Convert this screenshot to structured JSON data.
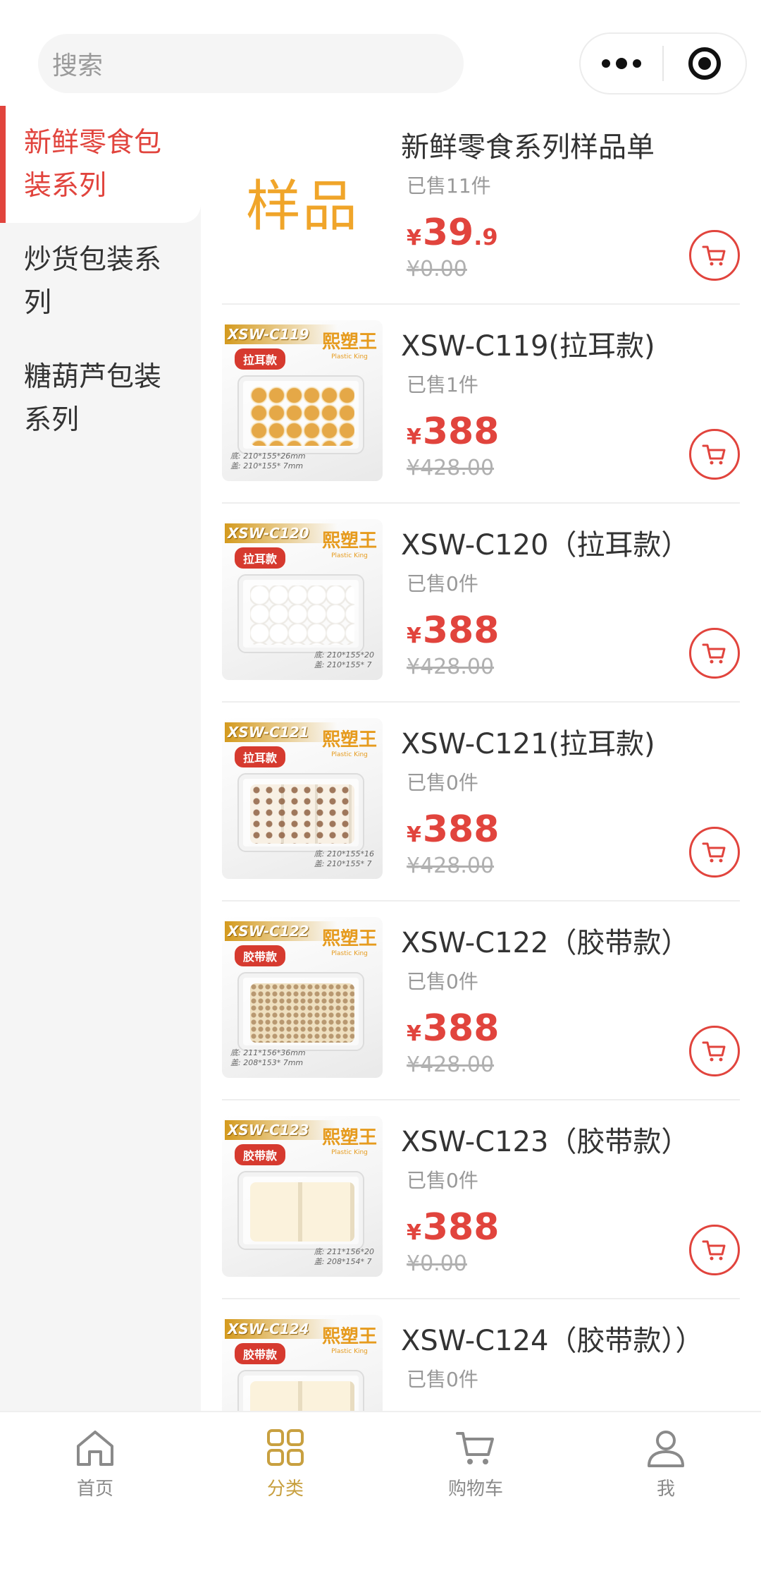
{
  "search": {
    "placeholder": "搜索"
  },
  "capsule": {
    "more_icon": "more-dots-icon",
    "target_icon": "target-icon"
  },
  "sidebar": {
    "items": [
      {
        "label": "新鲜零食包装系列",
        "active": true
      },
      {
        "label": "炒货包装系列",
        "active": false
      },
      {
        "label": "糖葫芦包装系列",
        "active": false
      }
    ]
  },
  "products": [
    {
      "name": "新鲜零食系列样品单",
      "sold": "已售11件",
      "price_symbol": "¥",
      "price_int": "39",
      "price_dec": ".9",
      "original": "¥0.00",
      "thumb_text": "样品"
    },
    {
      "name": "XSW-C119(拉耳款)",
      "sold": "已售1件",
      "price_symbol": "¥",
      "price_int": "388",
      "price_dec": "",
      "original": "¥428.00",
      "image_code": "XSW-C119",
      "image_tag": "拉耳款",
      "brand": "熙塑王",
      "brand_sub": "Plastic King",
      "spec_line1": "底: 210*155*26mm",
      "spec_line2": "盖: 210*155* 7mm"
    },
    {
      "name": "XSW-C120（拉耳款）",
      "sold": "已售0件",
      "price_symbol": "¥",
      "price_int": "388",
      "price_dec": "",
      "original": "¥428.00",
      "image_code": "XSW-C120",
      "image_tag": "拉耳款",
      "brand": "熙塑王",
      "brand_sub": "Plastic King",
      "spec_line1": "底: 210*155*20",
      "spec_line2": "盖: 210*155* 7"
    },
    {
      "name": "XSW-C121(拉耳款)",
      "sold": "已售0件",
      "price_symbol": "¥",
      "price_int": "388",
      "price_dec": "",
      "original": "¥428.00",
      "image_code": "XSW-C121",
      "image_tag": "拉耳款",
      "brand": "熙塑王",
      "brand_sub": "Plastic King",
      "spec_line1": "底: 210*155*16",
      "spec_line2": "盖: 210*155* 7"
    },
    {
      "name": "XSW-C122（胶带款）",
      "sold": "已售0件",
      "price_symbol": "¥",
      "price_int": "388",
      "price_dec": "",
      "original": "¥428.00",
      "image_code": "XSW-C122",
      "image_tag": "胶带款",
      "brand": "熙塑王",
      "brand_sub": "Plastic King",
      "spec_line1": "底: 211*156*36mm",
      "spec_line2": "盖: 208*153* 7mm"
    },
    {
      "name": "XSW-C123（胶带款）",
      "sold": "已售0件",
      "price_symbol": "¥",
      "price_int": "388",
      "price_dec": "",
      "original": "¥0.00",
      "image_code": "XSW-C123",
      "image_tag": "胶带款",
      "brand": "熙塑王",
      "brand_sub": "Plastic King",
      "spec_line1": "底: 211*156*20",
      "spec_line2": "盖: 208*154* 7"
    },
    {
      "name": "XSW-C124（胶带款））",
      "sold": "已售0件",
      "price_symbol": "¥",
      "price_int": "",
      "price_dec": "",
      "original": "",
      "image_code": "XSW-C124",
      "image_tag": "胶带款",
      "brand": "熙塑王",
      "brand_sub": "Plastic King"
    }
  ],
  "tabbar": {
    "items": [
      {
        "label": "首页",
        "icon": "home-icon",
        "active": false
      },
      {
        "label": "分类",
        "icon": "category-grid-icon",
        "active": true
      },
      {
        "label": "购物车",
        "icon": "cart-icon",
        "active": false
      },
      {
        "label": "我",
        "icon": "user-icon",
        "active": false
      }
    ]
  },
  "colors": {
    "accent": "#e1443d",
    "tab_active": "#c8a040",
    "tab_inactive": "#8a8a8a",
    "sidebar_bg": "#f5f5f5"
  }
}
